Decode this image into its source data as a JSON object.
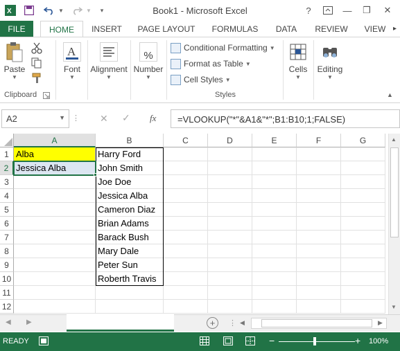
{
  "window": {
    "title": "Book1 - Microsoft Excel",
    "help": "?",
    "minimize": "—",
    "restore": "❐",
    "close": "✕"
  },
  "ribbon_tabs": [
    "FILE",
    "HOME",
    "INSERT",
    "PAGE LAYOUT",
    "FORMULAS",
    "DATA",
    "REVIEW",
    "VIEW"
  ],
  "ribbon": {
    "clipboard": {
      "paste": "Paste",
      "label": "Clipboard"
    },
    "font": "Font",
    "alignment": "Alignment",
    "number": "Number",
    "percent_symbol": "%",
    "styles": {
      "conditional": "Conditional Formatting",
      "format_table": "Format as Table",
      "cell_styles": "Cell Styles",
      "label": "Styles"
    },
    "cells": "Cells",
    "editing": "Editing"
  },
  "formula_bar": {
    "name_box": "A2",
    "fx": "fx",
    "formula": "=VLOOKUP(\"*\"&A1&\"*\";B1:B10;1;FALSE)"
  },
  "columns": [
    "A",
    "B",
    "C",
    "D",
    "E",
    "F",
    "G"
  ],
  "rows": [
    "1",
    "2",
    "3",
    "4",
    "5",
    "6",
    "7",
    "8",
    "9",
    "10",
    "11",
    "12"
  ],
  "column_a": [
    "Alba",
    "Jessica Alba"
  ],
  "column_b": [
    "Harry Ford",
    "John Smith",
    "Joe Doe",
    "Jessica Alba",
    "Cameron Diaz",
    "Brian Adams",
    "Barack Bush",
    "Mary Dale",
    "Peter Sun",
    "Roberth Travis"
  ],
  "colors": {
    "accent": "#217346",
    "highlight_a1": "#ffff00",
    "selected_a2": "#dce6f1"
  },
  "status": {
    "ready": "READY",
    "zoom": "100%"
  }
}
